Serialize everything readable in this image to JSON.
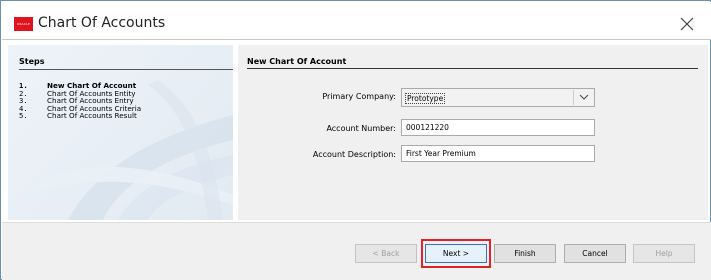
{
  "window": {
    "title": "Chart Of Accounts",
    "logo_text": "ORACLE"
  },
  "steps": {
    "title": "Steps",
    "items": [
      {
        "num": "1.",
        "label": "New Chart Of Account",
        "active": true
      },
      {
        "num": "2.",
        "label": "Chart Of Accounts Entity",
        "active": false
      },
      {
        "num": "3.",
        "label": "Chart Of Accounts Entry",
        "active": false
      },
      {
        "num": "4.",
        "label": "Chart Of Accounts Criteria",
        "active": false
      },
      {
        "num": "5.",
        "label": "Chart Of Accounts Result",
        "active": false
      }
    ]
  },
  "form": {
    "title": "New Chart Of Account",
    "primary_company_label": "Primary Company:",
    "primary_company_value": "Prototype",
    "account_number_label": "Account Number:",
    "account_number_value": "000121220",
    "account_description_label": "Account Description:",
    "account_description_value": "First Year Premium"
  },
  "buttons": {
    "back": "< Back",
    "next": "Next >",
    "finish": "Finish",
    "cancel": "Cancel",
    "help": "Help"
  },
  "colors": {
    "brand": "#e0131e",
    "focus_outline": "#e0232b"
  }
}
